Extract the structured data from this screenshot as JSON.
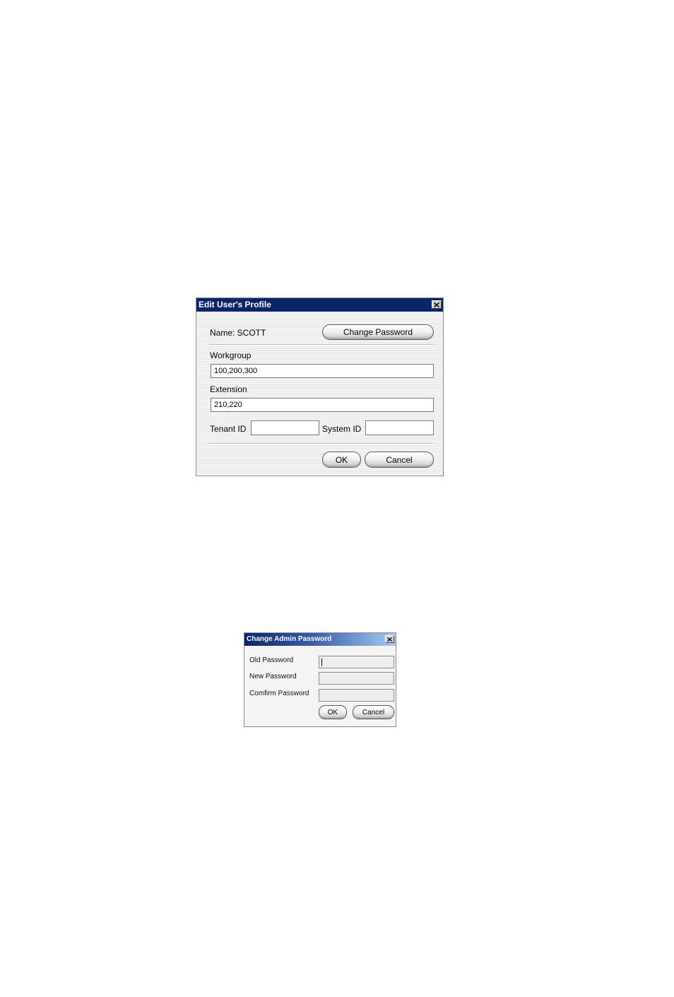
{
  "profile_dialog": {
    "title": "Edit User's Profile",
    "name_label": "Name: SCOTT",
    "change_password_button": "Change Password",
    "workgroup_label": "Workgroup",
    "workgroup_value": "100,200,300",
    "extension_label": "Extension",
    "extension_value": "210,220",
    "tenant_id_label": "Tenant ID",
    "tenant_id_value": "",
    "system_id_label": "System ID",
    "system_id_value": "",
    "ok_button": "OK",
    "cancel_button": "Cancel",
    "close_icon": "close-icon"
  },
  "password_dialog": {
    "title": "Change Admin Password",
    "old_password_label": "Old Password",
    "new_password_label": "New Password",
    "confirm_password_label": "Comfirm Password",
    "ok_button": "OK",
    "cancel_button": "Cancel",
    "close_icon": "close-icon"
  },
  "colors": {
    "titlebar": "#0a246a",
    "dialog_bg": "#f1f1f1"
  }
}
